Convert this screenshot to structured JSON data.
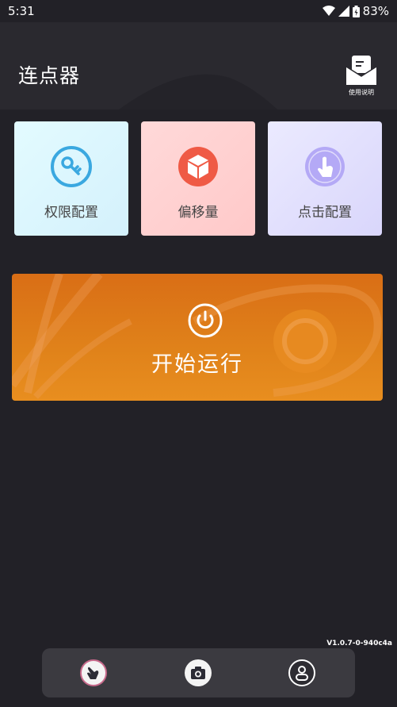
{
  "status_bar": {
    "time": "5:31",
    "battery": "83%"
  },
  "header": {
    "title": "连点器",
    "manual_label": "使用说明"
  },
  "cards": [
    {
      "label": "权限配置",
      "icon": "key-icon",
      "color": "#3aa8e0"
    },
    {
      "label": "偏移量",
      "icon": "box-icon",
      "color": "#ef5a45"
    },
    {
      "label": "点击配置",
      "icon": "tap-icon",
      "color": "#a79cf2"
    }
  ],
  "run_panel": {
    "label": "开始运行",
    "icon": "power-icon",
    "color": "#e0821a"
  },
  "version": "V1.0.7-0-940c4a",
  "bottom_nav": {
    "items": [
      "tap-nav-icon",
      "camera-icon",
      "profile-icon"
    ]
  }
}
